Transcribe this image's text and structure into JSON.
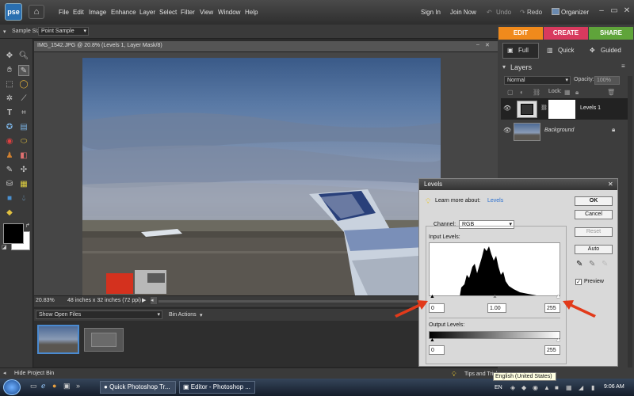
{
  "app": {
    "logo": "pse",
    "home_icon": "home-icon"
  },
  "menu": [
    "File",
    "Edit",
    "Image",
    "Enhance",
    "Layer",
    "Select",
    "Filter",
    "View",
    "Window",
    "Help"
  ],
  "right_menu": {
    "sign_in": "Sign In",
    "join_now": "Join Now",
    "undo": "Undo",
    "redo": "Redo",
    "organizer": "Organizer"
  },
  "options": {
    "sample_size_label": "Sample Size:",
    "sample_size_value": "Point Sample"
  },
  "document": {
    "tab_title": "IMG_1542.JPG @ 20.8% (Levels 1, Layer Mask/8)",
    "zoom": "20.83%",
    "dimensions": "48 inches x 32 inches (72 ppi)"
  },
  "bin": {
    "show_open_files": "Show Open Files",
    "bin_actions": "Bin Actions",
    "hide_project_bin": "Hide Project Bin",
    "tips": "Tips and Tricks"
  },
  "panel": {
    "tabs": {
      "edit": "EDIT",
      "create": "CREATE",
      "share": "SHARE"
    },
    "modes": {
      "full": "Full",
      "quick": "Quick",
      "guided": "Guided"
    },
    "layers_title": "Layers",
    "blend_mode": "Normal",
    "opacity_label": "Opacity:",
    "opacity_value": "100%",
    "lock_label": "Lock:",
    "layers": [
      {
        "name": "Levels 1"
      },
      {
        "name": "Background"
      }
    ]
  },
  "levels_dialog": {
    "title": "Levels",
    "learn_more": "Learn more about:",
    "learn_link": "Levels",
    "channel_label": "Channel:",
    "channel_value": "RGB",
    "input_levels_label": "Input Levels:",
    "input_black": "0",
    "input_gamma": "1.00",
    "input_white": "255",
    "output_levels_label": "Output Levels:",
    "output_black": "0",
    "output_white": "255",
    "buttons": {
      "ok": "OK",
      "cancel": "Cancel",
      "reset": "Reset",
      "auto": "Auto"
    },
    "preview_label": "Preview",
    "preview_checked": true
  },
  "taskbar": {
    "tasks": [
      "Quick Photoshop Tr...",
      "Editor - Photoshop ..."
    ],
    "tooltip": "English (United States)",
    "lang": "EN",
    "time": "9:06 AM"
  },
  "colors": {
    "edit_tab": "#f08a1c",
    "create_tab": "#d83a5e",
    "share_tab": "#5fa43a",
    "arrow": "#e23a1a"
  }
}
